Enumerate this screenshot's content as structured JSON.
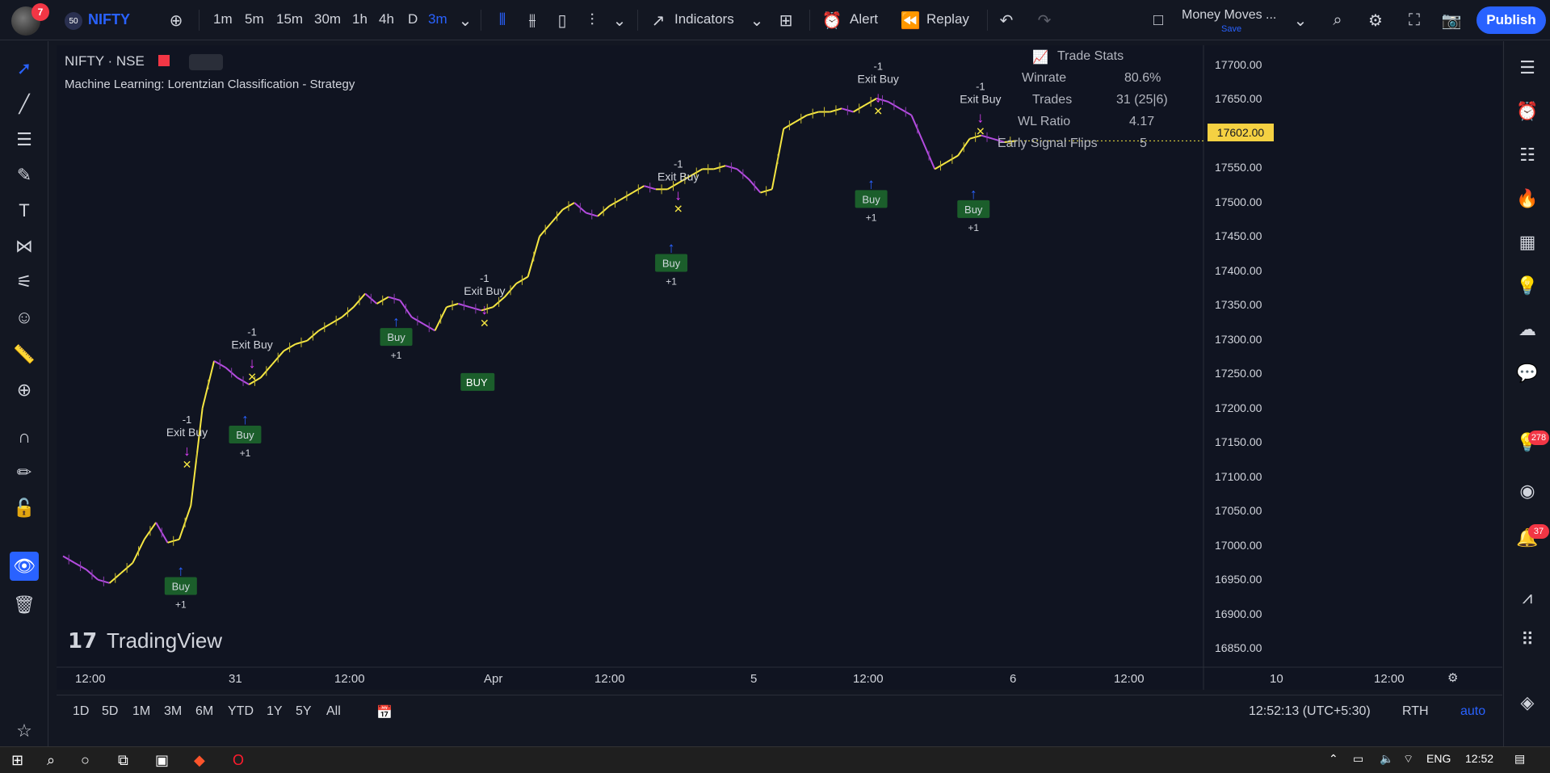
{
  "header": {
    "notif_count": "7",
    "symbol_badge": "50",
    "symbol": "NIFTY",
    "intervals": [
      "1m",
      "5m",
      "15m",
      "30m",
      "1h",
      "4h",
      "D",
      "3m"
    ],
    "indicators_label": "Indicators",
    "alert_label": "Alert",
    "replay_label": "Replay",
    "layout_name": "Money Moves ...",
    "layout_status": "Save",
    "publish_label": "Publish"
  },
  "legend": {
    "symbol": "NIFTY · NSE",
    "study": "Machine Learning: Lorentzian Classification - Strategy"
  },
  "stats": {
    "title": "Trade Stats",
    "rows": [
      {
        "label": "Winrate",
        "value": "80.6%"
      },
      {
        "label": "Trades",
        "value": "31 (25|6)"
      },
      {
        "label": "WL Ratio",
        "value": "4.17"
      },
      {
        "label": "Early Signal Flips",
        "value": "5"
      }
    ]
  },
  "chart_data": {
    "type": "line",
    "price_ticks": [
      "17700.00",
      "17650.00",
      "17600.00",
      "17550.00",
      "17500.00",
      "17450.00",
      "17400.00",
      "17350.00",
      "17300.00",
      "17250.00",
      "17200.00",
      "17150.00",
      "17100.00",
      "17050.00",
      "17000.00",
      "16950.00",
      "16900.00",
      "16850.00"
    ],
    "current_price": "17602.00",
    "time_ticks": [
      "12:00",
      "31",
      "12:00",
      "Apr",
      "12:00",
      "5",
      "12:00",
      "6",
      "12:00",
      "10",
      "12:00"
    ],
    "ylim": [
      16820,
      17720
    ],
    "x": [
      0,
      15,
      30,
      45,
      60,
      75,
      90,
      105,
      120,
      135,
      150,
      165,
      180,
      195,
      210,
      225,
      240,
      255,
      270,
      285,
      300,
      315,
      330,
      345,
      360,
      375,
      390,
      405,
      420,
      435,
      450,
      465,
      480,
      495,
      510,
      525,
      540,
      555,
      570,
      585,
      600,
      615,
      630,
      645,
      660,
      675,
      690,
      705,
      720,
      735,
      750,
      765,
      780,
      795,
      810,
      825,
      840,
      855,
      870,
      885,
      900,
      915,
      930,
      945,
      960,
      975,
      990,
      1005,
      1020,
      1035,
      1050,
      1065,
      1080,
      1095,
      1110,
      1125,
      1140,
      1155,
      1170,
      1185,
      1200,
      1215,
      1230
    ],
    "y": [
      16985,
      16975,
      16965,
      16950,
      16945,
      16960,
      16975,
      17010,
      17035,
      17005,
      17010,
      17060,
      17205,
      17275,
      17265,
      17250,
      17240,
      17250,
      17270,
      17290,
      17300,
      17305,
      17320,
      17330,
      17340,
      17355,
      17375,
      17360,
      17370,
      17365,
      17340,
      17330,
      17320,
      17355,
      17360,
      17355,
      17350,
      17355,
      17370,
      17390,
      17400,
      17460,
      17480,
      17500,
      17510,
      17495,
      17490,
      17505,
      17515,
      17525,
      17535,
      17530,
      17530,
      17540,
      17550,
      17560,
      17560,
      17565,
      17560,
      17545,
      17525,
      17530,
      17620,
      17630,
      17640,
      17645,
      17645,
      17650,
      17645,
      17655,
      17665,
      17660,
      17650,
      17640,
      17600,
      17560,
      17570,
      17580,
      17605,
      17610,
      17605,
      17600,
      17602
    ],
    "signals": [
      {
        "kind": "buy",
        "label": "Buy",
        "count": "+1",
        "x": 152,
        "price": 16985
      },
      {
        "kind": "exit",
        "label": "Exit Buy",
        "count": "-1",
        "x": 160,
        "price": 17120
      },
      {
        "kind": "buy",
        "label": "Buy",
        "count": "+1",
        "x": 235,
        "price": 17210
      },
      {
        "kind": "exit",
        "label": "Exit Buy",
        "count": "-1",
        "x": 244,
        "price": 17250
      },
      {
        "kind": "buy",
        "label": "Buy",
        "count": "+1",
        "x": 430,
        "price": 17355
      },
      {
        "kind": "exit",
        "label": "Exit Buy",
        "count": "-1",
        "x": 544,
        "price": 17330
      },
      {
        "kind": "buy2",
        "label": "BUY",
        "count": "",
        "x": 534,
        "price": 17305
      },
      {
        "kind": "buy",
        "label": "Buy",
        "count": "+1",
        "x": 785,
        "price": 17465
      },
      {
        "kind": "exit",
        "label": "Exit Buy",
        "count": "-1",
        "x": 794,
        "price": 17500
      },
      {
        "kind": "buy",
        "label": "Buy",
        "count": "+1",
        "x": 1043,
        "price": 17560
      },
      {
        "kind": "exit",
        "label": "Exit Buy",
        "count": "-1",
        "x": 1052,
        "price": 17645
      },
      {
        "kind": "buy",
        "label": "Buy",
        "count": "+1",
        "x": 1175,
        "price": 17545
      },
      {
        "kind": "exit",
        "label": "Exit Buy",
        "count": "-1",
        "x": 1184,
        "price": 17615
      }
    ]
  },
  "bottom": {
    "ranges": [
      "1D",
      "5D",
      "1M",
      "3M",
      "6M",
      "YTD",
      "1Y",
      "5Y",
      "All"
    ],
    "clock": "12:52:13 (UTC+5:30)",
    "session": "RTH",
    "scale": "auto"
  },
  "right_badges": {
    "ideas": "278",
    "notif": "37"
  },
  "taskbar": {
    "lang": "ENG",
    "time": "12:52"
  },
  "watermark": "TradingView"
}
